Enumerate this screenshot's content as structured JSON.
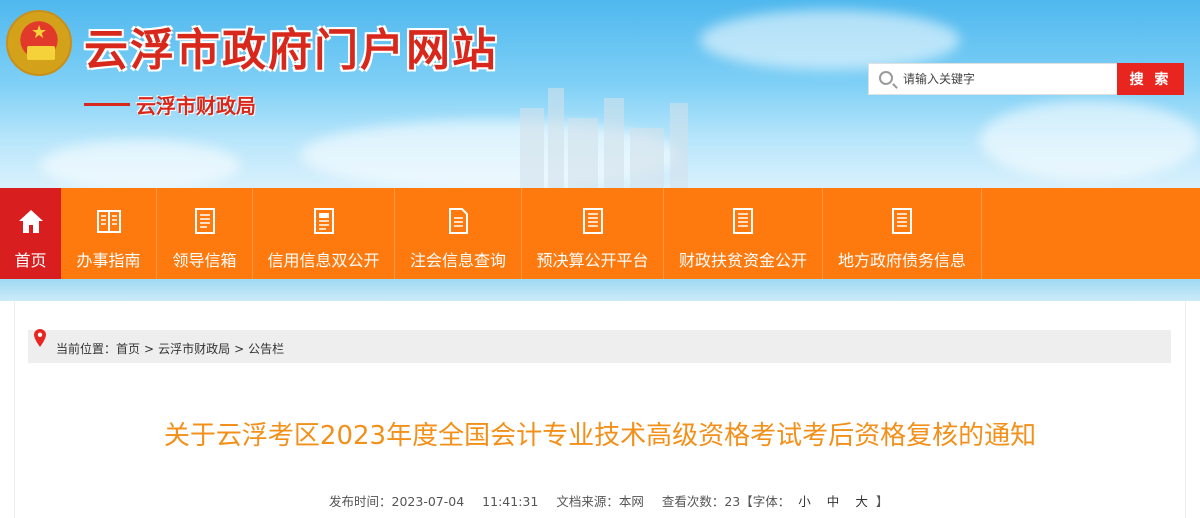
{
  "header": {
    "site_title": "云浮市政府门户网站",
    "dept_name": "云浮市财政局",
    "search": {
      "placeholder": "请输入关键字",
      "button_label": "搜 索"
    }
  },
  "nav": {
    "items": [
      {
        "label": "首页",
        "icon": "home-icon"
      },
      {
        "label": "办事指南",
        "icon": "book-icon"
      },
      {
        "label": "领导信箱",
        "icon": "document-icon"
      },
      {
        "label": "信用信息双公开",
        "icon": "document-icon"
      },
      {
        "label": "注会信息查询",
        "icon": "document-icon"
      },
      {
        "label": "预决算公开平台",
        "icon": "document-icon"
      },
      {
        "label": "财政扶贫资金公开",
        "icon": "document-icon"
      },
      {
        "label": "地方政府债务信息",
        "icon": "document-icon"
      }
    ]
  },
  "breadcrumb": {
    "prefix": "当前位置：",
    "items": [
      "首页",
      "云浮市财政局",
      "公告栏"
    ],
    "separator": ">"
  },
  "article": {
    "title": "关于云浮考区2023年度全国会计专业技术高级资格考试考后资格复核的通知",
    "meta": {
      "publish_label": "发布时间：",
      "publish_date": "2023-07-04",
      "publish_time": "11:41:31",
      "source_label": "文档来源：",
      "source": "本网",
      "views_label": "查看次数：",
      "views": "23",
      "font_label": "【字体：",
      "font_small": "小",
      "font_medium": "中",
      "font_large": "大",
      "font_close": "】"
    }
  },
  "colors": {
    "brand_red": "#d8281c",
    "nav_orange": "#ff7a0e",
    "home_red": "#d81e1e",
    "title_orange": "#f2901a",
    "search_button": "#e8251f"
  }
}
